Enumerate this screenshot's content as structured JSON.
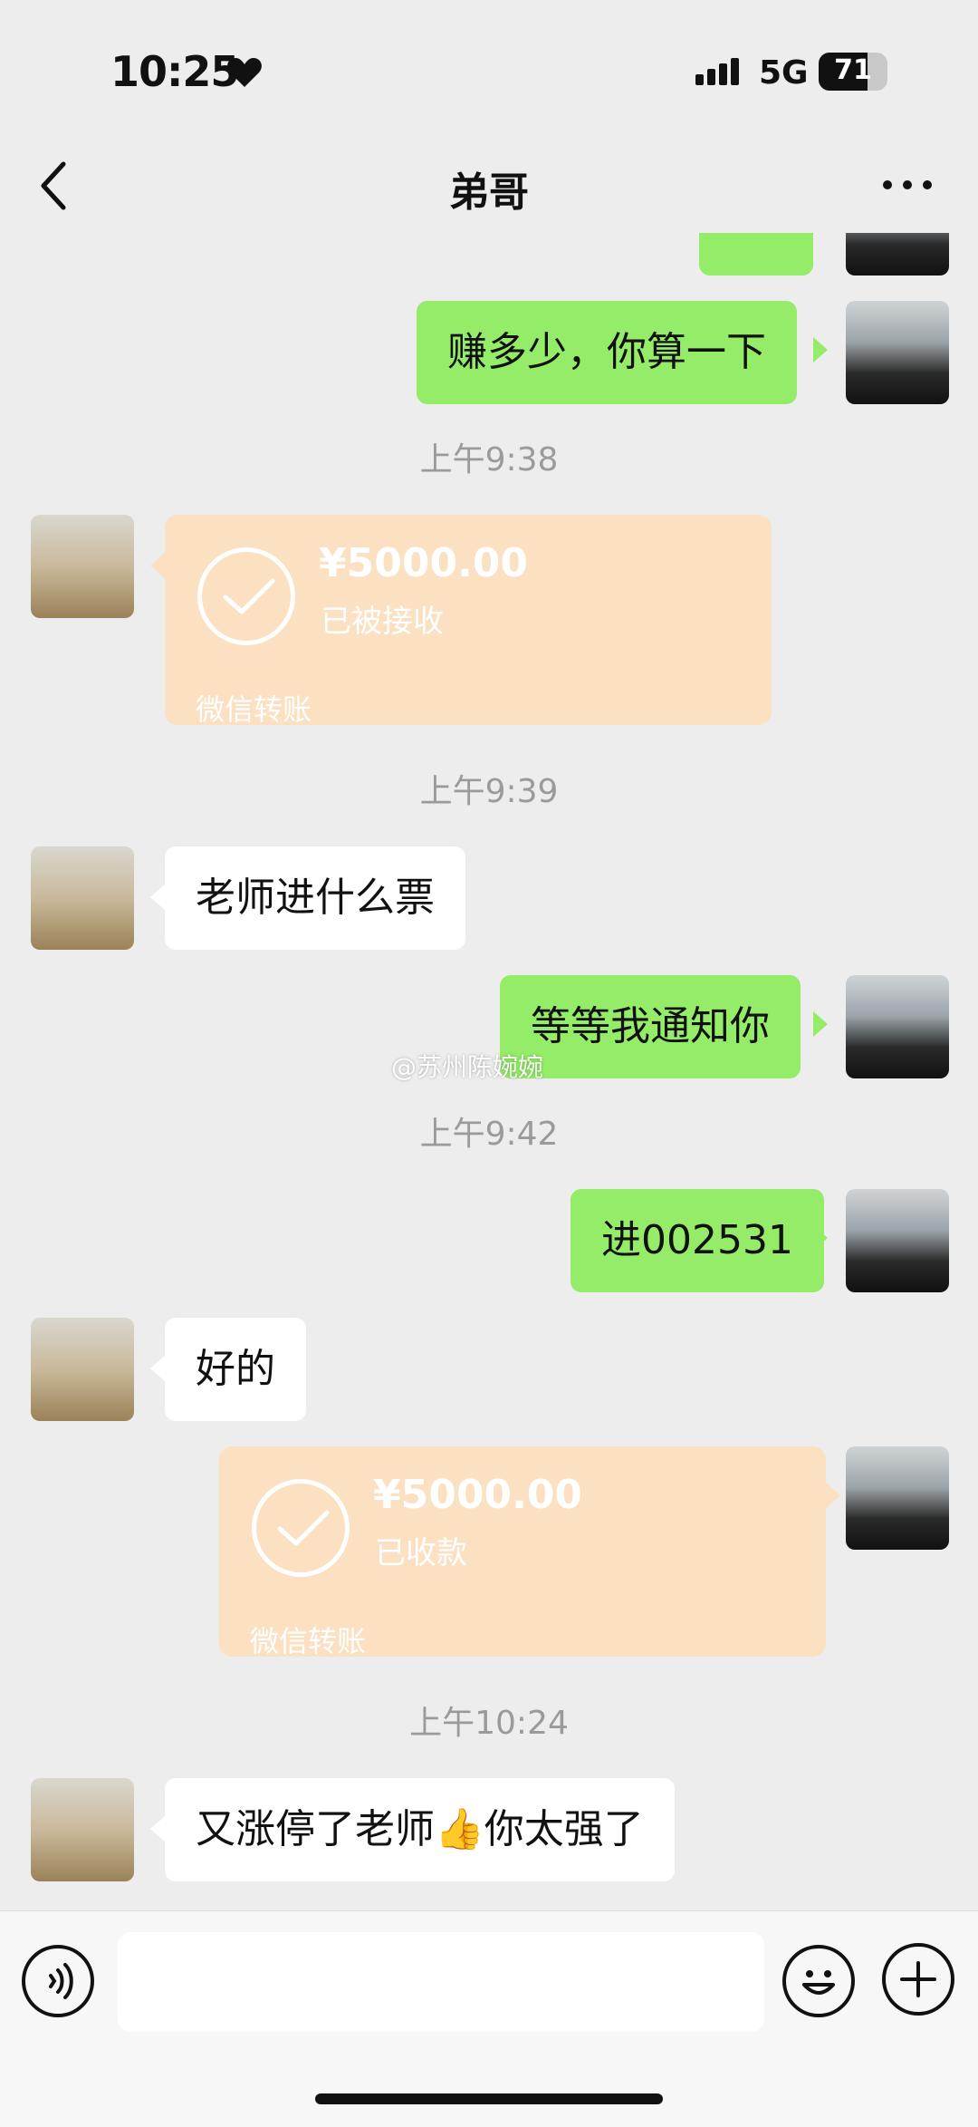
{
  "status_bar": {
    "time": "10:25",
    "network": "5G",
    "battery": "71",
    "battery_level": 0.71
  },
  "nav": {
    "title": "弟哥"
  },
  "messages": {
    "m1": "赚多少，你算一下",
    "t1": "上午9:38",
    "transfer1": {
      "amount": "¥5000.00",
      "status": "已被接收",
      "label": "微信转账"
    },
    "t2": "上午9:39",
    "m2": "老师进什么票",
    "m3": "等等我通知你",
    "t3": "上午9:42",
    "m4": "进002531",
    "m5": "好的",
    "transfer2": {
      "amount": "¥5000.00",
      "status": "已收款",
      "label": "微信转账"
    },
    "t4": "上午10:24",
    "m6": "又涨停了老师👍你太强了"
  },
  "watermark": "@苏州陈婉婉",
  "colors": {
    "background": "#ededed",
    "sent_bubble": "#95ec69",
    "received_bubble": "#ffffff",
    "transfer_card": "#fbe0c2"
  },
  "icons": [
    "heart-icon",
    "signal-icon",
    "battery-icon",
    "back-icon",
    "more-icon",
    "check-icon",
    "voice-icon",
    "emoji-icon",
    "plus-icon"
  ]
}
